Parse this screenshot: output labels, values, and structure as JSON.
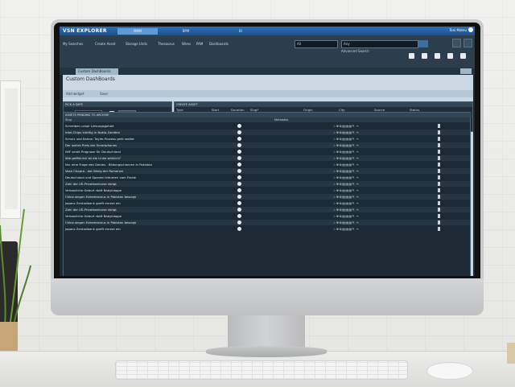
{
  "app": {
    "logo": "VSN EXPLORER",
    "tabs": [
      "MAM",
      "BPM",
      "BI"
    ],
    "active_tab": "MAM",
    "user": "Toni Mateu"
  },
  "menu": [
    "My Searches",
    "Create Asset",
    "Storage Units",
    "Thesaurus",
    "Wires",
    "PAM",
    "Dashboards"
  ],
  "search": {
    "scope": "All",
    "query": "Any",
    "advanced": "Advanced Search"
  },
  "doc_tab": "Custom DashBoards",
  "page": {
    "title": "Custom DashBoards",
    "add_widget": "Add widget",
    "save": "Save"
  },
  "pick_date": {
    "title": "PICK A DATE",
    "date": "08/12/2020",
    "button": "Value"
  },
  "create_asset": {
    "title": "CREATE ASSET",
    "labels": [
      "Type",
      "Start",
      "Duration",
      "Slug*",
      "Origin",
      "City",
      "Source",
      "Status"
    ],
    "placeholder": "Select a value",
    "button": "Add"
  },
  "assets": {
    "title": "ASSETS PENDING TO ARCHIVE",
    "col_slug": "Slug",
    "col_meta": "Metadata",
    "rows": [
      "Schreiben unser Leisungsgehalt",
      "Intel-Chips künftig in Nokia-Geräten",
      "Schulz und Kahne: Tayler-Prozess geht weiter",
      "Der wahre Preis der Smartphones",
      "IWF senkt Prognose für Deutschland",
      "Wie gefährlich ist die Linke wirklich?",
      "Nur eine Frage des Geldes - Bildungschancen in Pakistan",
      "Vash Chopra - der König der Romanze",
      "Deutschland und Spanien träumen vom Finale",
      "Zahl der US-Privatkonkurse steigt",
      "Verbauliche Geburt statt Babyklappe",
      "China wegen Extremismus in Pakistan besorgt",
      "Japans Zentralbank greift erneut ein",
      "Zahl der US-Privatkonkurse steigt",
      "Verbauliche Geburt statt Babyklappe",
      "China wegen Extremismus in Pakistan besorgt",
      "Japans Zentralbank greift erneut ein"
    ],
    "row_actions": "☆⊕⊗▤▤▤✎ ✂"
  }
}
